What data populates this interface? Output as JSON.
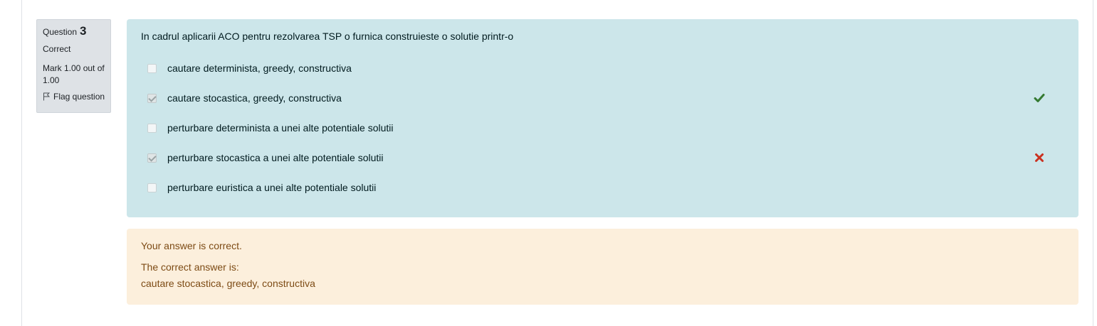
{
  "info": {
    "question_label": "Question",
    "question_number": "3",
    "state": "Correct",
    "grade": "Mark 1.00 out of 1.00",
    "flag_label": "Flag question"
  },
  "question": {
    "text": "In cadrul aplicarii ACO pentru rezolvarea TSP o furnica construieste o solutie printr-o",
    "answers": [
      {
        "label": "cautare determinista, greedy, constructiva",
        "checked": false,
        "feedback": ""
      },
      {
        "label": "cautare stocastica, greedy, constructiva",
        "checked": true,
        "feedback": "check-icon"
      },
      {
        "label": "perturbare determinista a unei alte potentiale solutii",
        "checked": false,
        "feedback": ""
      },
      {
        "label": "perturbare stocastica a unei alte potentiale solutii",
        "checked": true,
        "feedback": "cross-icon"
      },
      {
        "label": "perturbare euristica a unei alte potentiale solutii",
        "checked": false,
        "feedback": ""
      }
    ]
  },
  "outcome": {
    "general_feedback": "Your answer is correct.",
    "right_answer_label": "The correct answer is:",
    "right_answer_value": "cautare stocastica, greedy, constructiva"
  },
  "colors": {
    "correct": "#357a32",
    "incorrect": "#ca3120",
    "formulation_bg": "#cce6ea",
    "outcome_bg": "#fcefdc",
    "info_bg": "#dee2e6"
  }
}
